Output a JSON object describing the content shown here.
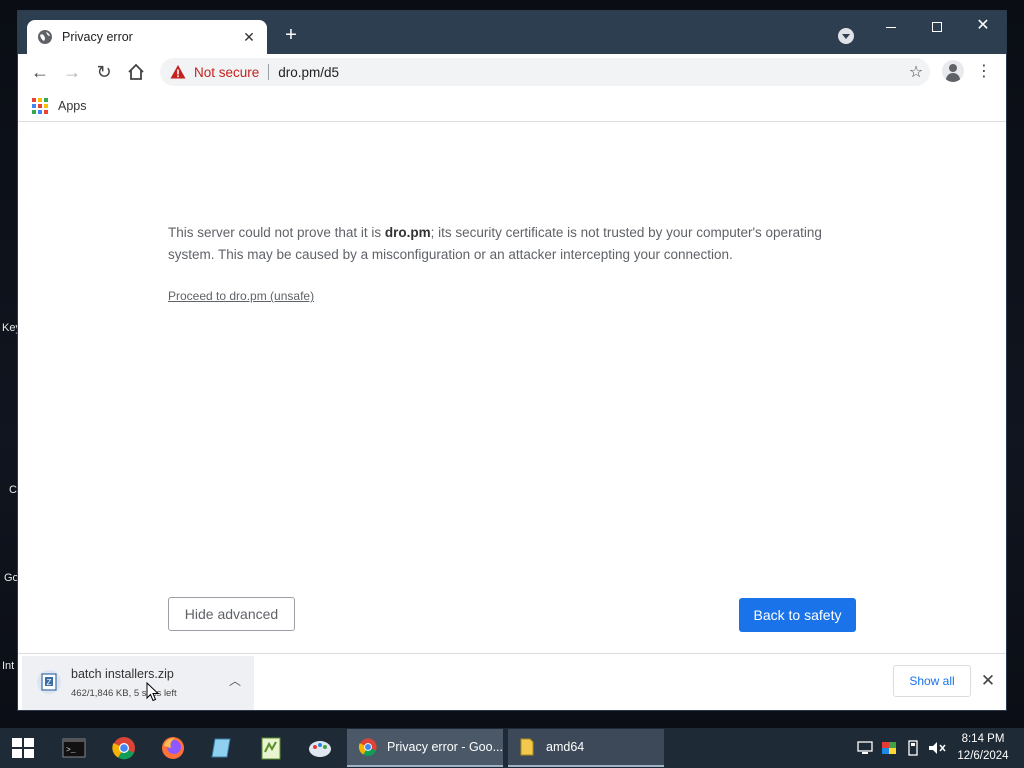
{
  "desktop": {
    "side_labels": [
      "Key",
      "C",
      "Go",
      "Int"
    ]
  },
  "browser": {
    "tab": {
      "title": "Privacy error",
      "icon": "globe-icon"
    },
    "toolbar": {
      "security_label": "Not secure",
      "url": "dro.pm/d5"
    },
    "bookmarks": {
      "apps_label": "Apps"
    }
  },
  "page": {
    "message_part1": "This server could not prove that it is ",
    "message_domain": "dro.pm",
    "message_part2": "; its security certificate is not trusted by your computer's operating system. This may be caused by a misconfiguration or an attacker intercepting your connection.",
    "proceed_link": "Proceed to dro.pm (unsafe)",
    "hide_advanced_label": "Hide advanced",
    "back_to_safety_label": "Back to safety"
  },
  "downloads": {
    "file_name": "batch installers.zip",
    "status": "462/1,846 KB, 5 secs left",
    "show_all_label": "Show all"
  },
  "taskbar": {
    "apps": [
      {
        "label": "Privacy error - Goo...",
        "icon": "chrome-icon"
      },
      {
        "label": "amd64",
        "icon": "folder-icon"
      }
    ],
    "time": "8:14 PM",
    "date": "12/6/2024"
  },
  "colors": {
    "accent": "#1a73e8",
    "danger": "#c5221f",
    "titlebar": "#2c3e50"
  }
}
